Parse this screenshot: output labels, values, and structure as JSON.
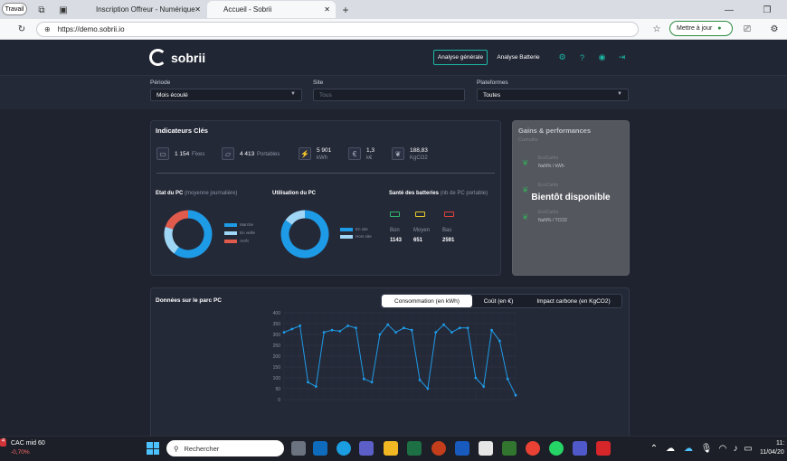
{
  "browser": {
    "profile_label": "Travail",
    "tabs": [
      {
        "label": "Inscription Offreur - Numérique"
      },
      {
        "label": "Accueil - Sobrii"
      }
    ],
    "address": "https://demo.sobrii.io",
    "update_label": "Mettre à jour"
  },
  "header": {
    "logo": "sobrii",
    "nav": [
      "Analyse générale",
      "Analyse Batterie"
    ]
  },
  "filters": {
    "periode": {
      "label": "Période",
      "value": "Mois écoulé"
    },
    "site": {
      "label": "Site",
      "placeholder": "Tous"
    },
    "plateformes": {
      "label": "Plateformes",
      "value": "Toutes"
    }
  },
  "indicators": {
    "title": "Indicateurs Clés",
    "items": [
      {
        "value": "1 154",
        "unit": "Fixes",
        "icon": "monitor-icon"
      },
      {
        "value": "4 413",
        "unit": "Portables",
        "icon": "laptop-icon"
      },
      {
        "value": "5 901",
        "unit": "kWh",
        "icon": "plug-icon"
      },
      {
        "value": "1,3",
        "unit": "k€",
        "icon": "money-icon"
      },
      {
        "value": "188,83",
        "unit": "KgCO2",
        "icon": "leaf-icon"
      }
    ],
    "etat": {
      "title": "Etat du PC",
      "subtitle": "(moyenne journalière)",
      "legend": [
        "Marche",
        "En veille",
        "Arrêt"
      ],
      "colors": [
        "#1e9be6",
        "#9fd6f5",
        "#e05b4b"
      ],
      "values": [
        60,
        20,
        20
      ]
    },
    "utilisation": {
      "title": "Utilisation du PC",
      "legend": [
        "En site",
        "Hors site"
      ],
      "colors": [
        "#1e9be6",
        "#9fd6f5"
      ],
      "values": [
        85,
        15
      ]
    },
    "sante": {
      "title": "Santé des batteries",
      "subtitle": "(nb de PC portable)",
      "items": [
        {
          "label": "Bon",
          "value": "1143",
          "color": "#2fb36b"
        },
        {
          "label": "Moyen",
          "value": "651",
          "color": "#e2c72b"
        },
        {
          "label": "Bas",
          "value": "2591",
          "color": "#e0403a"
        }
      ]
    }
  },
  "gains": {
    "title": "Gains & performances",
    "subtitle": "Cumulés",
    "items": [
      {
        "label": "EcoCarbo",
        "value": "NaN% / kWh"
      },
      {
        "label": "EcoCarbo",
        "value": ""
      },
      {
        "label": "EcoCarbo",
        "value": "NaN% / TCO2"
      }
    ],
    "overlay": "Bientôt disponible"
  },
  "parc": {
    "title": "Données sur le parc PC",
    "tabs": [
      "Consommation (en kWh)",
      "Coût (en €)",
      "Impact carbone (en KgCO2)"
    ],
    "active_tab": 0
  },
  "chart_data": {
    "type": "line",
    "yticks": [
      0,
      50,
      100,
      150,
      200,
      250,
      300,
      350,
      400
    ],
    "ylim": [
      0,
      400
    ],
    "series": [
      {
        "values": [
          310,
          325,
          340,
          80,
          60,
          310,
          320,
          315,
          340,
          330,
          95,
          80,
          300,
          345,
          310,
          330,
          320,
          90,
          50,
          310,
          345,
          310,
          330,
          330,
          100,
          60,
          320,
          270,
          95,
          20
        ]
      }
    ],
    "color": "#1e9be6"
  },
  "taskbar": {
    "ticker_name": "CAC mid 60",
    "ticker_change": "-0,70%",
    "ticker_badge": "4",
    "search_placeholder": "Rechercher",
    "time": "11:",
    "date": "11/04/20"
  }
}
